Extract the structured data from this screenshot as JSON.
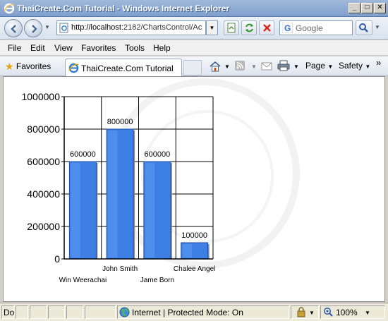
{
  "window": {
    "title": "ThaiCreate.Com Tutorial - Windows Internet Explorer",
    "minimize_glyph": "_",
    "maximize_glyph": "□",
    "close_glyph": "✕"
  },
  "navbar": {
    "address_host": "http://localhost",
    "address_rest": ":2182/ChartsControl/Ac",
    "search_placeholder": "Google"
  },
  "menubar": {
    "items": [
      "File",
      "Edit",
      "View",
      "Favorites",
      "Tools",
      "Help"
    ]
  },
  "favbar": {
    "favorites_label": "Favorites",
    "tab_label": "ThaiCreate.Com Tutorial",
    "page_label": "Page",
    "safety_label": "Safety",
    "more_glyph": "»"
  },
  "chart_data": {
    "type": "bar",
    "categories": [
      "Win Weerachai",
      "John Smith",
      "Jame Born",
      "Chalee Angel"
    ],
    "values": [
      600000,
      800000,
      600000,
      100000
    ],
    "data_labels": [
      "600000",
      "800000",
      "600000",
      "100000"
    ],
    "y_ticks": [
      0,
      200000,
      400000,
      600000,
      800000,
      1000000
    ],
    "ylim": [
      0,
      1000000
    ],
    "grid": true,
    "bar_color": "#3e7fe6"
  },
  "statusbar": {
    "done_text": "Do",
    "zone_text": "Internet | Protected Mode: On",
    "zoom_text": "100%"
  }
}
